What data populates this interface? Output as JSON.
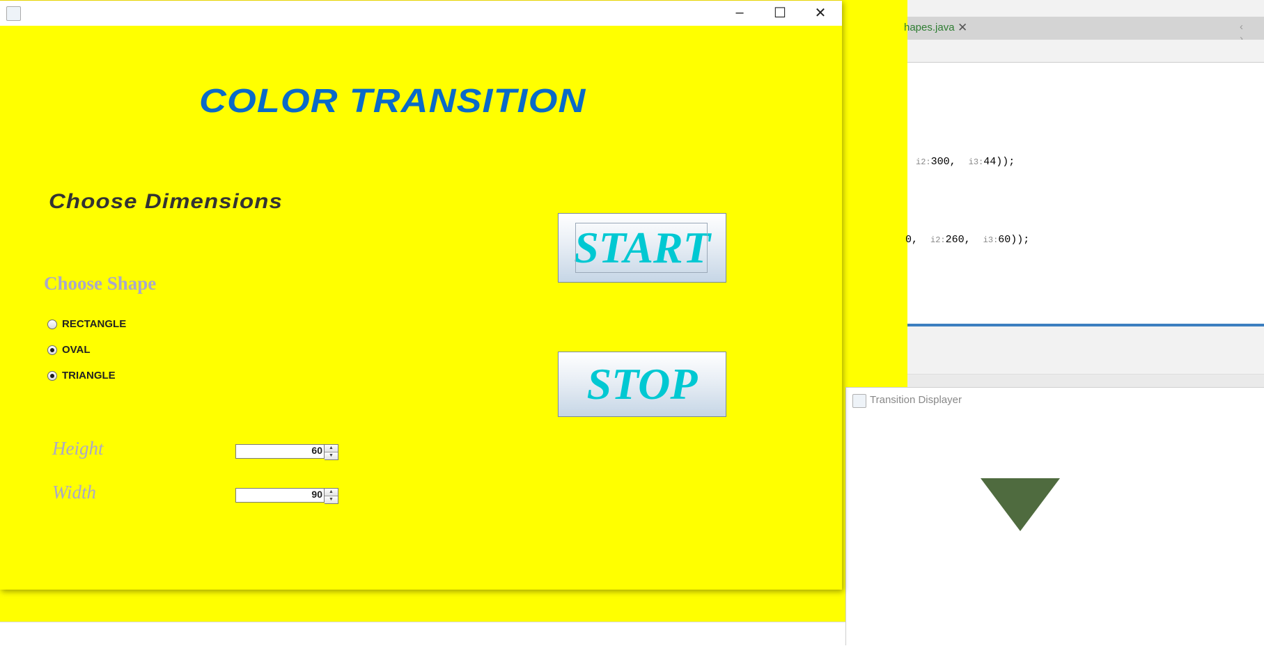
{
  "main_window": {
    "title": "",
    "heading": "COLOR TRANSITION",
    "dimensions_label": "Choose Dimensions",
    "shape_label": "Choose Shape",
    "shapes": [
      {
        "label": "RECTANGLE",
        "checked": false
      },
      {
        "label": "OVAL",
        "checked": true
      },
      {
        "label": "TRIANGLE",
        "checked": true
      }
    ],
    "height_label": "Height",
    "height_value": "60",
    "width_label": "Width",
    "width_value": "90",
    "start_label": "START",
    "stop_label": "STOP",
    "window_controls": {
      "minimize": "–",
      "maximize": "☐",
      "close": "✕"
    }
  },
  "ide": {
    "tab_name": "hapes.java",
    "tab_close": "✕",
    "nav": "‹ ›",
    "code_line_1": {
      "hint_a": "i2:",
      "val_a": "300,",
      "hint_b": "i3:",
      "val_b": "44));"
    },
    "code_line_2": {
      "prefix": "0,",
      "hint_a": "i2:",
      "val_a": "260,",
      "hint_b": "i3:",
      "val_b": "60));"
    }
  },
  "displayer": {
    "title": "Transition Displayer",
    "shape_color": "#4f6b3f"
  },
  "colors": {
    "background": "#ffff00",
    "heading": "#0a6ac8",
    "button_text": "#00c8d2",
    "label_muted": "#aaa8c9"
  }
}
